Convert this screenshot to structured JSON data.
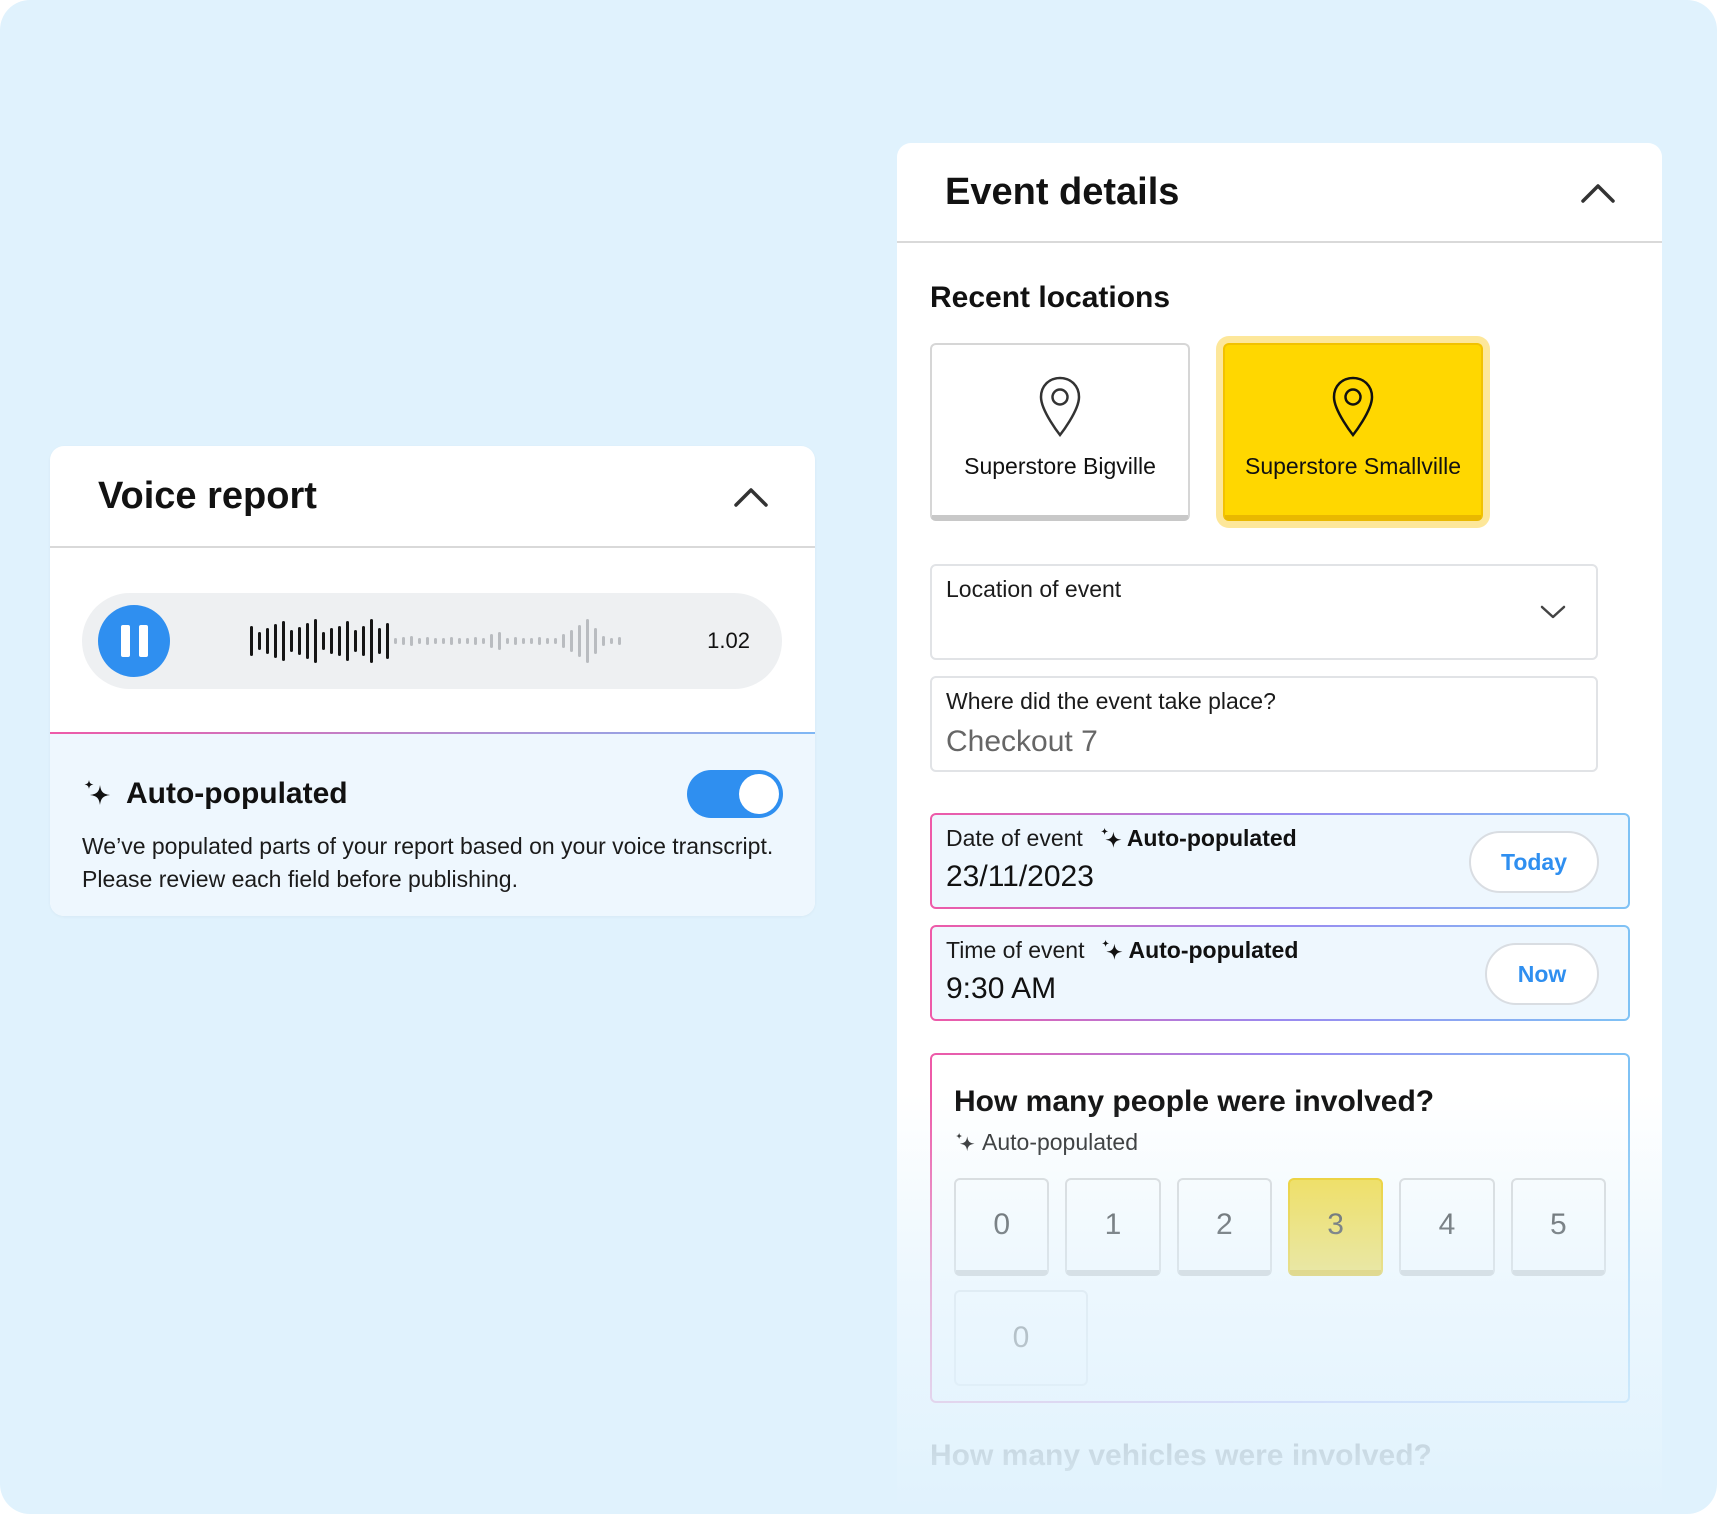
{
  "voice_report": {
    "title": "Voice report",
    "player_time": "1.02",
    "auto_title": "Auto-populated",
    "auto_desc_line1": "We’ve populated parts of your report based on your voice transcript.",
    "auto_desc_line2": "Please review each field before publishing.",
    "toggle_on": true
  },
  "event_details": {
    "title": "Event details",
    "recent_locations_title": "Recent locations",
    "locations": [
      {
        "label": "Superstore Bigville",
        "selected": false
      },
      {
        "label": "Superstore Smallville",
        "selected": true
      }
    ],
    "location_field": {
      "label": "Location of event",
      "value": ""
    },
    "place_field": {
      "label": "Where did the event take place?",
      "value": "Checkout 7"
    },
    "date_field": {
      "label": "Date of event",
      "badge": "Auto-populated",
      "value": "23/11/2023",
      "button": "Today"
    },
    "time_field": {
      "label": "Time of event",
      "badge": "Auto-populated",
      "value": "9:30 AM",
      "button": "Now"
    },
    "people_question": {
      "title": "How many people were involved?",
      "badge": "Auto-populated",
      "options": [
        "0",
        "1",
        "2",
        "3",
        "4",
        "5"
      ],
      "selected": "3",
      "other_value": "0"
    },
    "next_question": "How many vehicles were involved?"
  },
  "colors": {
    "background": "#e0f2fd",
    "accent_blue": "#2f8ff0",
    "selected_yellow": "#ffd700",
    "gradient_pink": "#ee5aa8",
    "gradient_blue": "#7fc2f5"
  },
  "icons": [
    "chevron-up-icon",
    "pause-icon",
    "sparkle-icon",
    "map-pin-icon",
    "chevron-down-icon"
  ]
}
